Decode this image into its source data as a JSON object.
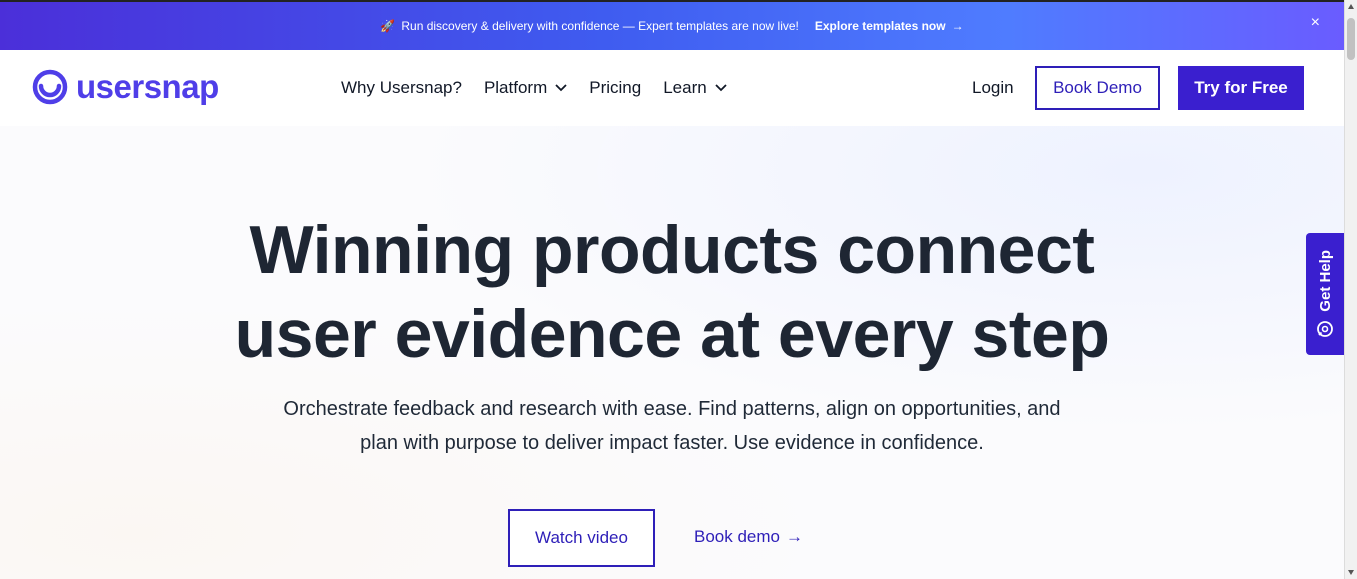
{
  "announcement": {
    "rocket_icon": "🚀",
    "message": "Run discovery & delivery with confidence — Expert templates are now live!",
    "cta": "Explore templates now",
    "arrow": "→",
    "close": "×"
  },
  "nav": {
    "logo_text": "usersnap",
    "items": [
      {
        "label": "Why Usersnap?",
        "dropdown": false
      },
      {
        "label": "Platform",
        "dropdown": true
      },
      {
        "label": "Pricing",
        "dropdown": false
      },
      {
        "label": "Learn",
        "dropdown": true
      }
    ],
    "login": "Login",
    "book_demo": "Book Demo",
    "try_free": "Try for Free"
  },
  "hero": {
    "headline_line1": "Winning products connect",
    "headline_line2": "user evidence at every step",
    "subcopy": "Orchestrate feedback and research with ease. Find patterns, align on opportunities, and plan with purpose to deliver impact faster. Use evidence in confidence.",
    "watch_video": "Watch video",
    "book_demo_link": "Book demo",
    "arrow": "→"
  },
  "help_widget": {
    "label": "Get Help"
  },
  "colors": {
    "brand": "#4f3ee8",
    "primary_button": "#3a1fcf",
    "headline": "#1e2633"
  }
}
